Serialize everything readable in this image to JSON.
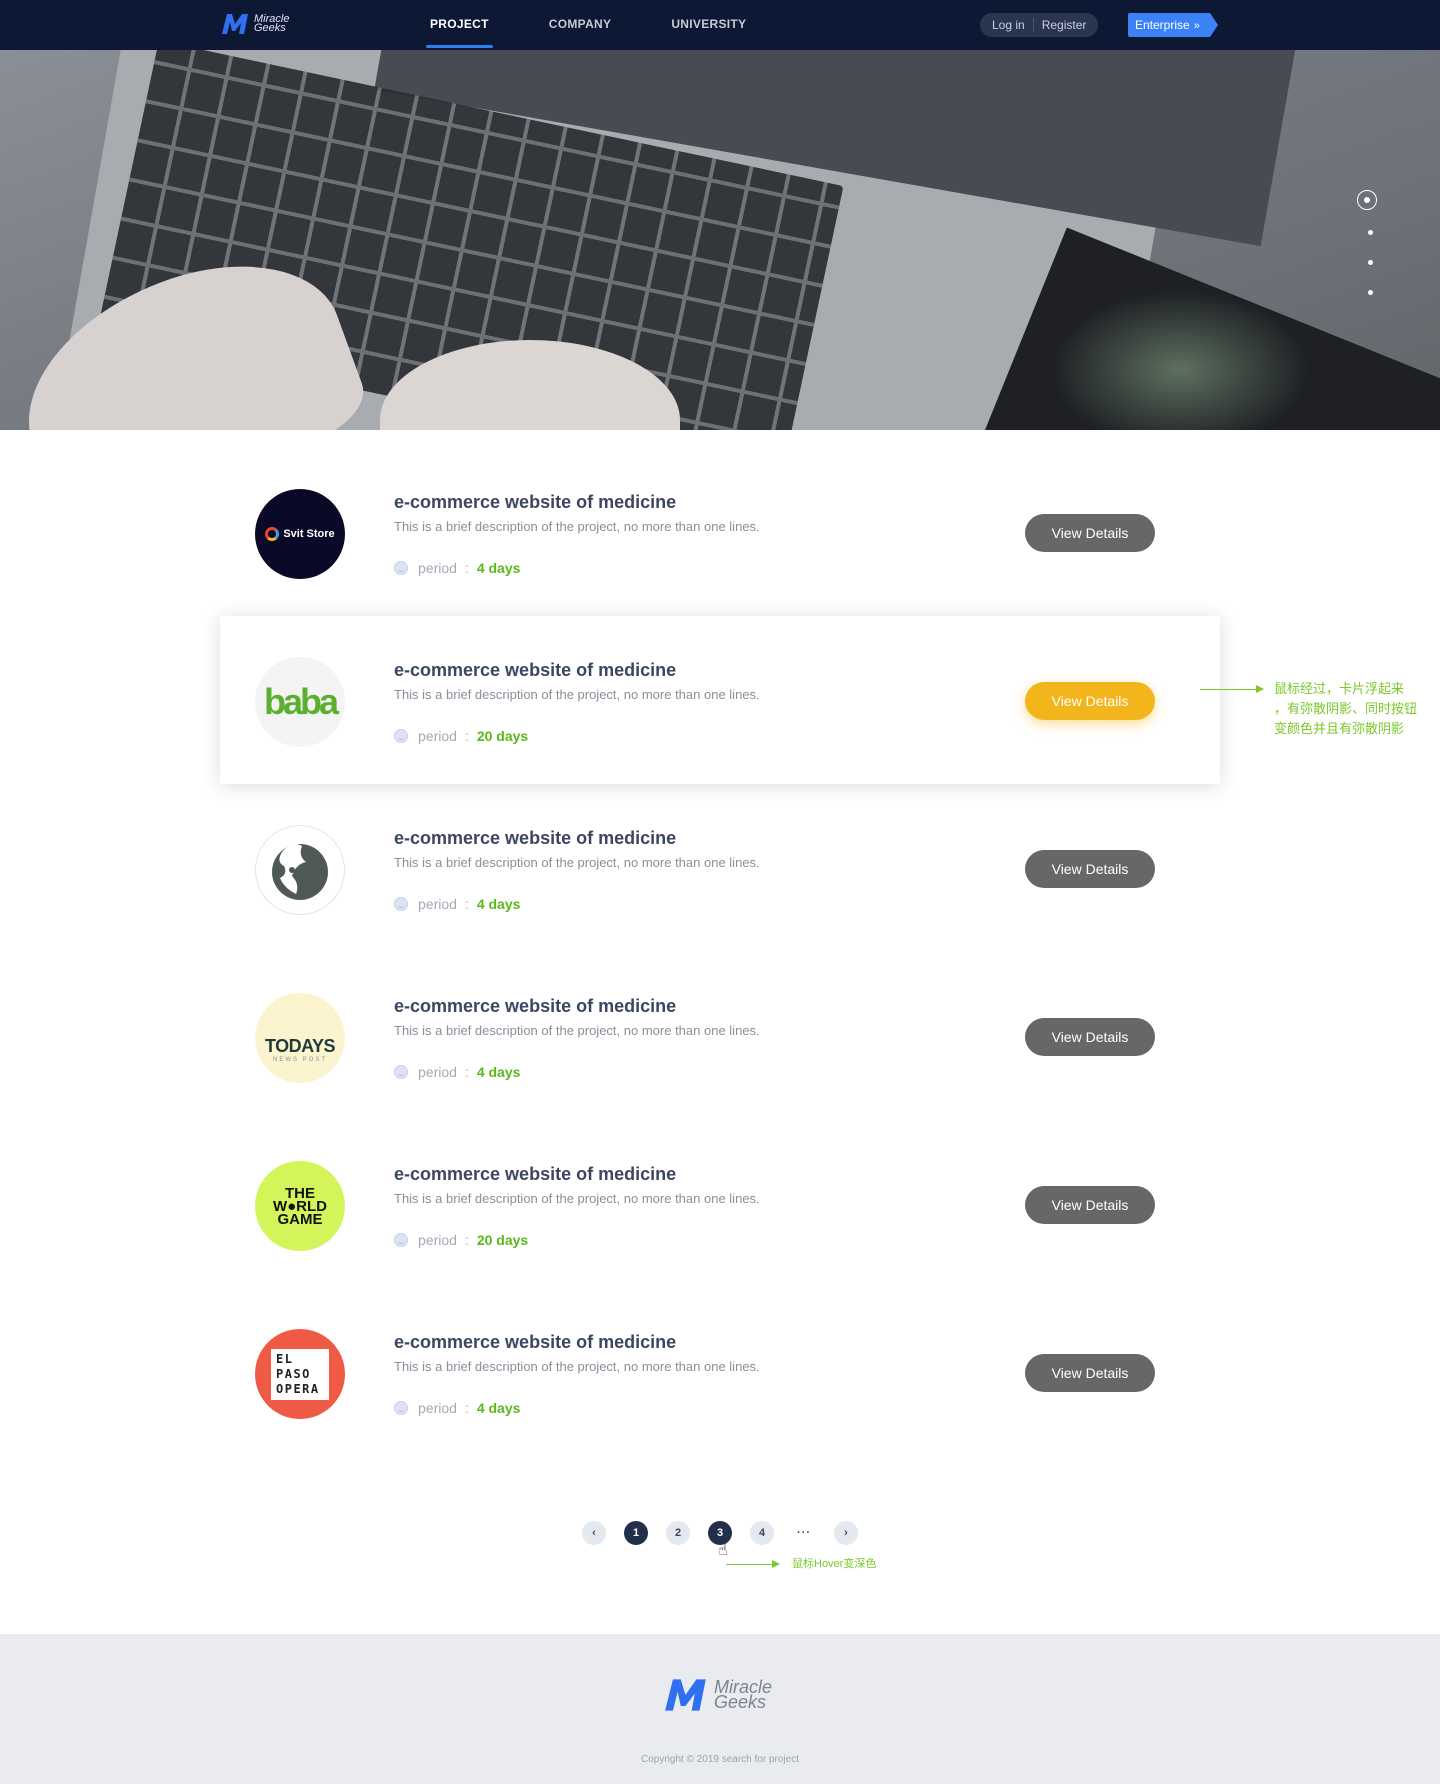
{
  "nav": {
    "logo_line1": "Miracle",
    "logo_line2": "Geeks",
    "links": [
      {
        "label": "PROJECT"
      },
      {
        "label": "COMPANY"
      },
      {
        "label": "UNIVERSITY"
      }
    ],
    "login": "Log in",
    "register": "Register",
    "enterprise": "Enterprise",
    "enterprise_icon": "double-chevron-right-icon",
    "active_link": "PROJECT",
    "accent_color": "#2f7ff5"
  },
  "hero": {
    "slides": 4,
    "active_slide": 1
  },
  "projects": [
    {
      "logo_text": "Svit Store",
      "logo": "svit-store-logo",
      "title": "e-commerce website of medicine",
      "desc": "This is a brief description of the project, no more than one lines.",
      "period_label": "period",
      "period_sep": ":",
      "period_value": "4 days",
      "button": "View Details"
    },
    {
      "logo_text": "baba",
      "logo": "baba-logo",
      "title": "e-commerce website of medicine",
      "desc": "This is a brief description of the project, no more than one lines.",
      "period_label": "period",
      "period_sep": ":",
      "period_value": "20 days",
      "button": "View Details",
      "hovered": true
    },
    {
      "logo_text": "",
      "logo": "lion-logo",
      "title": "e-commerce website of medicine",
      "desc": "This is a brief description of the project, no more than one lines.",
      "period_label": "period",
      "period_sep": ":",
      "period_value": "4 days",
      "button": "View Details"
    },
    {
      "logo_text": "TODAYS",
      "logo_subtext": "NEWS POST",
      "logo": "todays-news-post-logo",
      "title": "e-commerce website of medicine",
      "desc": "This is a brief description of the project, no more than one lines.",
      "period_label": "period",
      "period_sep": ":",
      "period_value": "4 days",
      "button": "View Details"
    },
    {
      "logo_text": "THE W●RLD GAME",
      "logo": "the-world-game-logo",
      "title": "e-commerce website of medicine",
      "desc": "This is a brief description of the project, no more than one lines.",
      "period_label": "period",
      "period_sep": ":",
      "period_value": "20 days",
      "button": "View Details"
    },
    {
      "logo_text": "EL PASO OPERA",
      "logo": "el-paso-opera-logo",
      "title": "e-commerce website of medicine",
      "desc": "This is a brief description of the project, no more than one lines.",
      "period_label": "period",
      "period_sep": ":",
      "period_value": "4 days",
      "button": "View Details"
    }
  ],
  "annotations": {
    "card_hover": [
      "鼠标经过，卡片浮起来",
      "，有弥散阴影、同时按钮",
      "变颜色并且有弥散阴影"
    ],
    "pager_hover": "鼠标Hover变深色"
  },
  "pagination": {
    "prev": "‹",
    "pages": [
      "1",
      "2",
      "3",
      "4"
    ],
    "ellipsis": "···",
    "next": "›",
    "current": "1",
    "hovered": "3"
  },
  "footer": {
    "logo_line1": "Miracle",
    "logo_line2": "Geeks",
    "copyright": "Copyright © 2019 search for project"
  },
  "colors": {
    "nav_bg": "#0d1834",
    "button_default": "#666769",
    "button_hover": "#f2b51b",
    "period_value": "#5cb81a",
    "annotation": "#7bc82b",
    "footer_bg": "#e9ebee"
  }
}
